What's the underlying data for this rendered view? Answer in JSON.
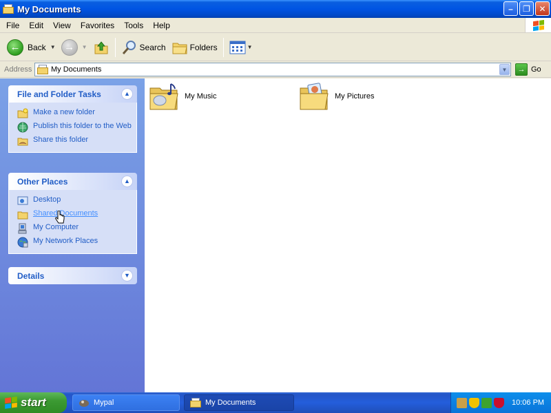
{
  "window": {
    "title": "My Documents",
    "minimize": "–",
    "maximize": "❐",
    "close": "✕"
  },
  "menu": [
    "File",
    "Edit",
    "View",
    "Favorites",
    "Tools",
    "Help"
  ],
  "toolbar": {
    "back_label": "Back",
    "search_label": "Search",
    "folders_label": "Folders"
  },
  "address": {
    "label": "Address",
    "value": "My Documents",
    "go_label": "Go"
  },
  "panels": {
    "file_tasks": {
      "title": "File and Folder Tasks",
      "items": [
        "Make a new folder",
        "Publish this folder to the Web",
        "Share this folder"
      ]
    },
    "other_places": {
      "title": "Other Places",
      "items": [
        "Desktop",
        "Shared Documents",
        "My Computer",
        "My Network Places"
      ]
    },
    "details": {
      "title": "Details"
    }
  },
  "content": {
    "items": [
      "My Music",
      "My Pictures"
    ]
  },
  "taskbar": {
    "start_label": "start",
    "buttons": [
      "Mypal",
      "My Documents"
    ],
    "clock": "10:06 PM"
  },
  "colors": {
    "title_bar": "#0054e3",
    "panel_link": "#215dc6",
    "left_pane_top": "#7ba2e7",
    "left_pane_bottom": "#6375d6",
    "start_button": "#3c9a33",
    "tray": "#0a74d9"
  }
}
